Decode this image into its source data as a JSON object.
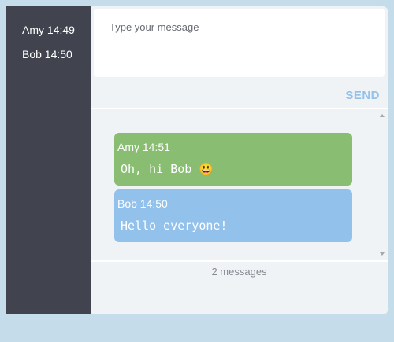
{
  "sidebar": {
    "users": [
      {
        "label": "Amy 14:49"
      },
      {
        "label": "Bob 14:50"
      }
    ]
  },
  "composer": {
    "placeholder": "Type your message",
    "value": "",
    "send_label": "SEND"
  },
  "messages": [
    {
      "header": "Amy 14:51",
      "text": "Oh, hi Bob  😃",
      "color": "#88bd72"
    },
    {
      "header": "Bob 14:50",
      "text": "Hello everyone!",
      "color": "#92c1eb"
    }
  ],
  "footer": {
    "count_label": "2 messages"
  },
  "colors": {
    "page_bg": "#c5dceb",
    "sidebar_bg": "#41444f",
    "accent": "#92c1eb"
  }
}
